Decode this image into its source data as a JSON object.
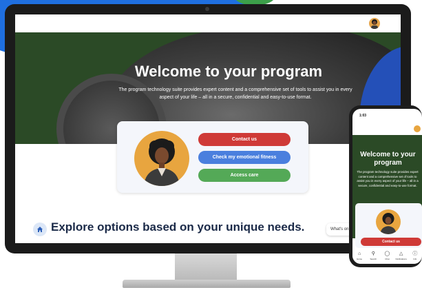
{
  "desktop": {
    "hero_title": "Welcome to your program",
    "hero_subtitle": "The program technology suite provides expert content and a comprehensive set of tools to assist you in every aspect of your life – all in a secure, confidential and easy-to-use format.",
    "buttons": {
      "contact_us": "Contact us",
      "emotional_fitness": "Check my emotional fitness",
      "access_care": "Access care"
    },
    "explore_text": "Explore options based on your unique needs.",
    "whats_on_text": "What's on your mind?"
  },
  "phone": {
    "status_time": "1:03",
    "hero_title": "Welcome to your program",
    "hero_subtitle": "The program technology suite provides expert content and a comprehensive set of tools to assist you in every aspect of your life – all in a secure, confidential and easy-to-use format.",
    "contact_button": "Contact us",
    "nav": [
      {
        "label": "Home",
        "icon": "home-icon"
      },
      {
        "label": "Search",
        "icon": "search-icon"
      },
      {
        "label": "Chat",
        "icon": "chat-icon"
      },
      {
        "label": "Notifications",
        "icon": "bell-icon"
      },
      {
        "label": "Info",
        "icon": "info-icon"
      }
    ]
  },
  "colors": {
    "hero_green": "#2b4a26",
    "contact_red": "#cf3a37",
    "fitness_blue": "#4a7fde",
    "care_green": "#54a957",
    "accent_blue": "#1f6fe0"
  }
}
